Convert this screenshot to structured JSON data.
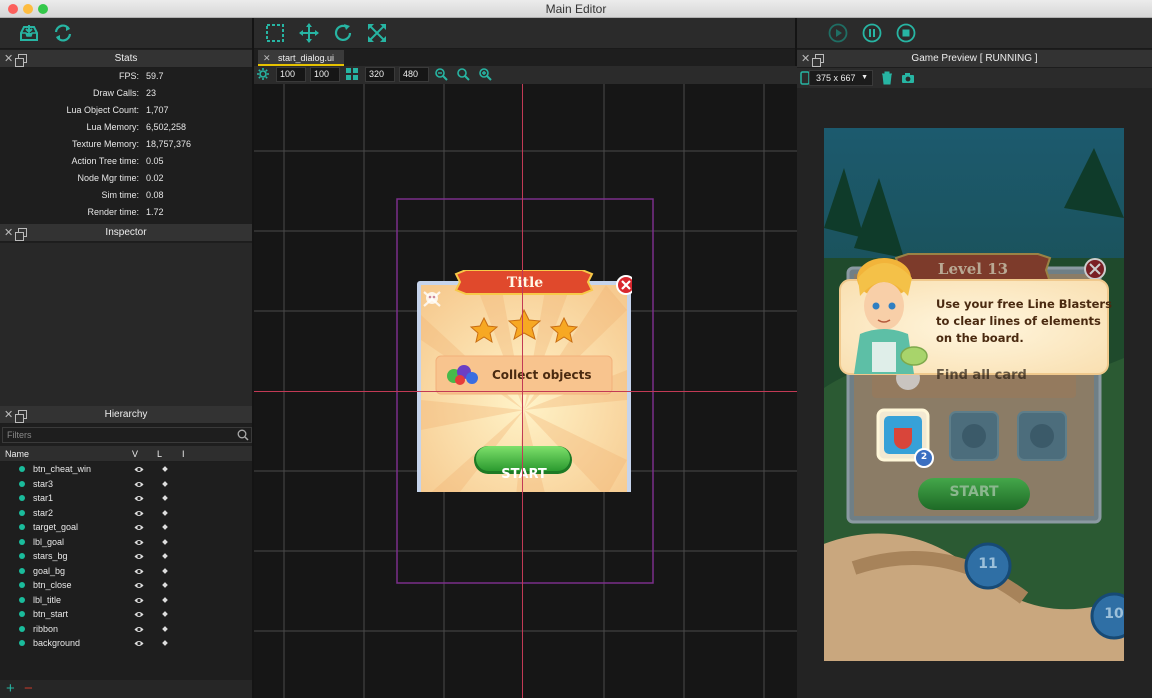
{
  "window": {
    "title": "Main Editor"
  },
  "stats_panel": {
    "title": "Stats",
    "rows": [
      {
        "label": "FPS:",
        "value": "59.7"
      },
      {
        "label": "Draw Calls:",
        "value": "23"
      },
      {
        "label": "Lua Object Count:",
        "value": "1,707"
      },
      {
        "label": "Lua Memory:",
        "value": "6,502,258"
      },
      {
        "label": "Texture Memory:",
        "value": "18,757,376"
      },
      {
        "label": "Action Tree time:",
        "value": "0.05"
      },
      {
        "label": "Node Mgr time:",
        "value": "0.02"
      },
      {
        "label": "Sim time:",
        "value": "0.08"
      },
      {
        "label": "Render time:",
        "value": "1.72"
      }
    ]
  },
  "inspector_panel": {
    "title": "Inspector"
  },
  "hierarchy_panel": {
    "title": "Hierarchy",
    "filter_placeholder": "Filters",
    "columns": {
      "name": "Name",
      "v": "V",
      "l": "L",
      "i": "I"
    },
    "items": [
      "btn_cheat_win",
      "star3",
      "star1",
      "star2",
      "target_goal",
      "lbl_goal",
      "stars_bg",
      "goal_bg",
      "btn_close",
      "lbl_title",
      "btn_start",
      "ribbon",
      "background"
    ],
    "add_label": "+",
    "remove_label": "−"
  },
  "editor": {
    "tab_label": "start_dialog.ui",
    "tab_close": "✕",
    "pos_x": "100",
    "pos_y": "100",
    "size_w": "320",
    "size_h": "480"
  },
  "dialog": {
    "title": "Title",
    "goal_text": "Collect objects",
    "start_label": "START"
  },
  "preview": {
    "title": "Game Preview [ RUNNING ]",
    "resolution": "375 x 667",
    "level_title": "Level 13",
    "tutorial_text": [
      "Use your free Line Blasters",
      "to clear lines of elements",
      "on the board."
    ],
    "goal_text": "Find all card",
    "start_label": "START",
    "badge_count": "2",
    "path_number_1": "11",
    "path_number_2": "10"
  },
  "colors": {
    "accent_green": "#1abc9c",
    "toolbar_icon": "#27b5a3",
    "ribbon_red": "#e0492c",
    "start_green": "#39b54a"
  }
}
